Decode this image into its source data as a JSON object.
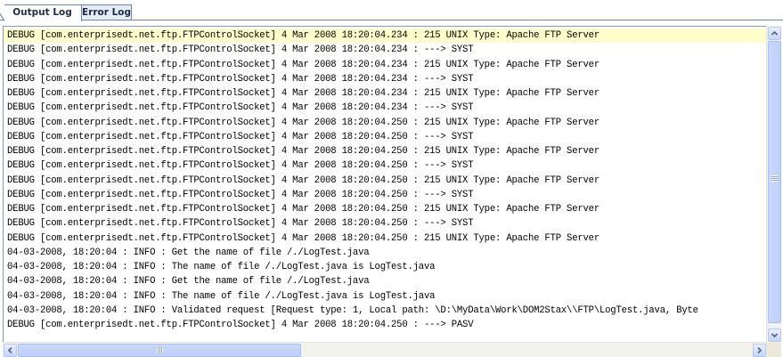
{
  "tabs": [
    {
      "label": "Output Log",
      "active": true
    },
    {
      "label": "Error Log",
      "active": false
    }
  ],
  "log": {
    "lines": [
      "DEBUG [com.enterprisedt.net.ftp.FTPControlSocket] 4 Mar 2008 18:20:04.234 : 215 UNIX Type: Apache FTP Server",
      "DEBUG [com.enterprisedt.net.ftp.FTPControlSocket] 4 Mar 2008 18:20:04.234 : ---> SYST",
      "DEBUG [com.enterprisedt.net.ftp.FTPControlSocket] 4 Mar 2008 18:20:04.234 : 215 UNIX Type: Apache FTP Server",
      "DEBUG [com.enterprisedt.net.ftp.FTPControlSocket] 4 Mar 2008 18:20:04.234 : ---> SYST",
      "DEBUG [com.enterprisedt.net.ftp.FTPControlSocket] 4 Mar 2008 18:20:04.234 : 215 UNIX Type: Apache FTP Server",
      "DEBUG [com.enterprisedt.net.ftp.FTPControlSocket] 4 Mar 2008 18:20:04.234 : ---> SYST",
      "DEBUG [com.enterprisedt.net.ftp.FTPControlSocket] 4 Mar 2008 18:20:04.250 : 215 UNIX Type: Apache FTP Server",
      "DEBUG [com.enterprisedt.net.ftp.FTPControlSocket] 4 Mar 2008 18:20:04.250 : ---> SYST",
      "DEBUG [com.enterprisedt.net.ftp.FTPControlSocket] 4 Mar 2008 18:20:04.250 : 215 UNIX Type: Apache FTP Server",
      "DEBUG [com.enterprisedt.net.ftp.FTPControlSocket] 4 Mar 2008 18:20:04.250 : ---> SYST",
      "DEBUG [com.enterprisedt.net.ftp.FTPControlSocket] 4 Mar 2008 18:20:04.250 : 215 UNIX Type: Apache FTP Server",
      "DEBUG [com.enterprisedt.net.ftp.FTPControlSocket] 4 Mar 2008 18:20:04.250 : ---> SYST",
      "DEBUG [com.enterprisedt.net.ftp.FTPControlSocket] 4 Mar 2008 18:20:04.250 : 215 UNIX Type: Apache FTP Server",
      "DEBUG [com.enterprisedt.net.ftp.FTPControlSocket] 4 Mar 2008 18:20:04.250 : ---> SYST",
      "DEBUG [com.enterprisedt.net.ftp.FTPControlSocket] 4 Mar 2008 18:20:04.250 : 215 UNIX Type: Apache FTP Server",
      "04-03-2008, 18:20:04 : INFO : Get the name of file /./LogTest.java",
      "04-03-2008, 18:20:04 : INFO : The name of file /./LogTest.java is LogTest.java",
      "04-03-2008, 18:20:04 : INFO : Get the name of file /./LogTest.java",
      "04-03-2008, 18:20:04 : INFO : The name of file /./LogTest.java is LogTest.java",
      "04-03-2008, 18:20:04 : INFO : Validated request [Request type: 1, Local path: \\D:\\MyData\\Work\\DOM2Stax\\\\FTP\\LogTest.java, Byte",
      "DEBUG [com.enterprisedt.net.ftp.FTPControlSocket] 4 Mar 2008 18:20:04.250 : ---> PASV"
    ],
    "highlight_index": 0
  },
  "colors": {
    "highlight": "#ffffcc",
    "tab_border": "#6e86a9",
    "scrollbar_thumb": "#c3d5fd"
  },
  "icons": {
    "scroll_up": "chevron-up-icon",
    "scroll_down": "chevron-down-icon",
    "scroll_left": "chevron-left-icon",
    "scroll_right": "chevron-right-icon"
  }
}
